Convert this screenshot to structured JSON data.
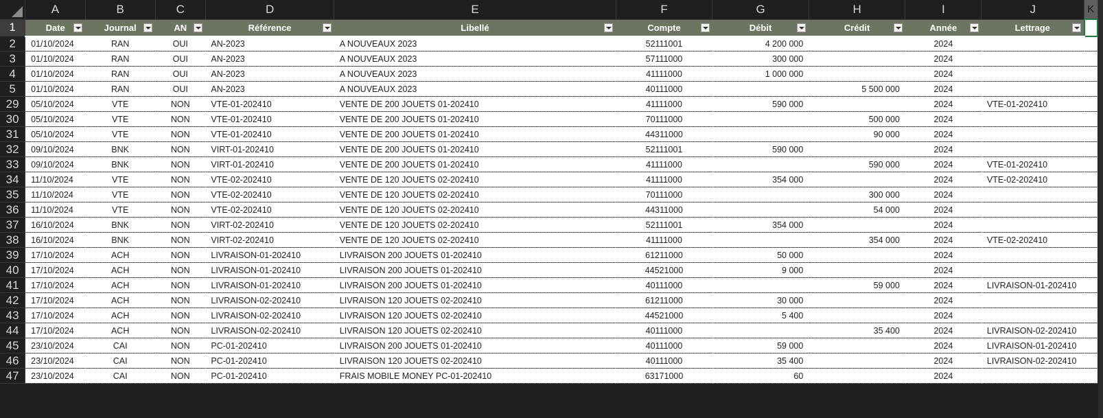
{
  "column_letters": [
    "A",
    "B",
    "C",
    "D",
    "E",
    "F",
    "G",
    "H",
    "I",
    "J",
    "K"
  ],
  "headers": [
    "Date",
    "Journal",
    "AN",
    "Référence",
    "Libellé",
    "Compte",
    "Débit",
    "Crédit",
    "Année",
    "Lettrage"
  ],
  "header_row_number": "1",
  "rows": [
    {
      "n": "2",
      "date": "01/10/2024",
      "journal": "RAN",
      "an": "OUI",
      "ref": "AN-2023",
      "libelle": "A NOUVEAUX 2023",
      "compte": "52111001",
      "debit": "4 200 000",
      "credit": "",
      "annee": "2024",
      "lettrage": ""
    },
    {
      "n": "3",
      "date": "01/10/2024",
      "journal": "RAN",
      "an": "OUI",
      "ref": "AN-2023",
      "libelle": "A NOUVEAUX 2023",
      "compte": "57111000",
      "debit": "300 000",
      "credit": "",
      "annee": "2024",
      "lettrage": ""
    },
    {
      "n": "4",
      "date": "01/10/2024",
      "journal": "RAN",
      "an": "OUI",
      "ref": "AN-2023",
      "libelle": "A NOUVEAUX 2023",
      "compte": "41111000",
      "debit": "1 000 000",
      "credit": "",
      "annee": "2024",
      "lettrage": ""
    },
    {
      "n": "5",
      "date": "01/10/2024",
      "journal": "RAN",
      "an": "OUI",
      "ref": "AN-2023",
      "libelle": "A NOUVEAUX 2023",
      "compte": "40111000",
      "debit": "",
      "credit": "5 500 000",
      "annee": "2024",
      "lettrage": ""
    },
    {
      "n": "29",
      "date": "05/10/2024",
      "journal": "VTE",
      "an": "NON",
      "ref": "VTE-01-202410",
      "libelle": "VENTE DE 200 JOUETS 01-202410",
      "compte": "41111000",
      "debit": "590 000",
      "credit": "",
      "annee": "2024",
      "lettrage": "VTE-01-202410"
    },
    {
      "n": "30",
      "date": "05/10/2024",
      "journal": "VTE",
      "an": "NON",
      "ref": "VTE-01-202410",
      "libelle": "VENTE DE 200 JOUETS 01-202410",
      "compte": "70111000",
      "debit": "",
      "credit": "500 000",
      "annee": "2024",
      "lettrage": ""
    },
    {
      "n": "31",
      "date": "05/10/2024",
      "journal": "VTE",
      "an": "NON",
      "ref": "VTE-01-202410",
      "libelle": "VENTE DE 200 JOUETS 01-202410",
      "compte": "44311000",
      "debit": "",
      "credit": "90 000",
      "annee": "2024",
      "lettrage": ""
    },
    {
      "n": "32",
      "date": "09/10/2024",
      "journal": "BNK",
      "an": "NON",
      "ref": "VIRT-01-202410",
      "libelle": "VENTE DE 200 JOUETS 01-202410",
      "compte": "52111001",
      "debit": "590 000",
      "credit": "",
      "annee": "2024",
      "lettrage": ""
    },
    {
      "n": "33",
      "date": "09/10/2024",
      "journal": "BNK",
      "an": "NON",
      "ref": "VIRT-01-202410",
      "libelle": "VENTE DE 200 JOUETS 01-202410",
      "compte": "41111000",
      "debit": "",
      "credit": "590 000",
      "annee": "2024",
      "lettrage": "VTE-01-202410"
    },
    {
      "n": "34",
      "date": "11/10/2024",
      "journal": "VTE",
      "an": "NON",
      "ref": "VTE-02-202410",
      "libelle": "VENTE DE 120 JOUETS 02-202410",
      "compte": "41111000",
      "debit": "354 000",
      "credit": "",
      "annee": "2024",
      "lettrage": "VTE-02-202410"
    },
    {
      "n": "35",
      "date": "11/10/2024",
      "journal": "VTE",
      "an": "NON",
      "ref": "VTE-02-202410",
      "libelle": "VENTE DE 120 JOUETS 02-202410",
      "compte": "70111000",
      "debit": "",
      "credit": "300 000",
      "annee": "2024",
      "lettrage": ""
    },
    {
      "n": "36",
      "date": "11/10/2024",
      "journal": "VTE",
      "an": "NON",
      "ref": "VTE-02-202410",
      "libelle": "VENTE DE 120 JOUETS 02-202410",
      "compte": "44311000",
      "debit": "",
      "credit": "54 000",
      "annee": "2024",
      "lettrage": ""
    },
    {
      "n": "37",
      "date": "16/10/2024",
      "journal": "BNK",
      "an": "NON",
      "ref": "VIRT-02-202410",
      "libelle": "VENTE DE 120 JOUETS 02-202410",
      "compte": "52111001",
      "debit": "354 000",
      "credit": "",
      "annee": "2024",
      "lettrage": ""
    },
    {
      "n": "38",
      "date": "16/10/2024",
      "journal": "BNK",
      "an": "NON",
      "ref": "VIRT-02-202410",
      "libelle": "VENTE DE 120 JOUETS 02-202410",
      "compte": "41111000",
      "debit": "",
      "credit": "354 000",
      "annee": "2024",
      "lettrage": "VTE-02-202410"
    },
    {
      "n": "39",
      "date": "17/10/2024",
      "journal": "ACH",
      "an": "NON",
      "ref": "LIVRAISON-01-202410",
      "libelle": "LIVRAISON 200 JOUETS 01-202410",
      "compte": "61211000",
      "debit": "50 000",
      "credit": "",
      "annee": "2024",
      "lettrage": ""
    },
    {
      "n": "40",
      "date": "17/10/2024",
      "journal": "ACH",
      "an": "NON",
      "ref": "LIVRAISON-01-202410",
      "libelle": "LIVRAISON 200 JOUETS 01-202410",
      "compte": "44521000",
      "debit": "9 000",
      "credit": "",
      "annee": "2024",
      "lettrage": ""
    },
    {
      "n": "41",
      "date": "17/10/2024",
      "journal": "ACH",
      "an": "NON",
      "ref": "LIVRAISON-01-202410",
      "libelle": "LIVRAISON 200 JOUETS 01-202410",
      "compte": "40111000",
      "debit": "",
      "credit": "59 000",
      "annee": "2024",
      "lettrage": "LIVRAISON-01-202410"
    },
    {
      "n": "42",
      "date": "17/10/2024",
      "journal": "ACH",
      "an": "NON",
      "ref": "LIVRAISON-02-202410",
      "libelle": "LIVRAISON 120 JOUETS 02-202410",
      "compte": "61211000",
      "debit": "30 000",
      "credit": "",
      "annee": "2024",
      "lettrage": ""
    },
    {
      "n": "43",
      "date": "17/10/2024",
      "journal": "ACH",
      "an": "NON",
      "ref": "LIVRAISON-02-202410",
      "libelle": "LIVRAISON 120 JOUETS 02-202410",
      "compte": "44521000",
      "debit": "5 400",
      "credit": "",
      "annee": "2024",
      "lettrage": ""
    },
    {
      "n": "44",
      "date": "17/10/2024",
      "journal": "ACH",
      "an": "NON",
      "ref": "LIVRAISON-02-202410",
      "libelle": "LIVRAISON 120 JOUETS 02-202410",
      "compte": "40111000",
      "debit": "",
      "credit": "35 400",
      "annee": "2024",
      "lettrage": "LIVRAISON-02-202410"
    },
    {
      "n": "45",
      "date": "23/10/2024",
      "journal": "CAI",
      "an": "NON",
      "ref": "PC-01-202410",
      "libelle": "LIVRAISON 200 JOUETS 01-202410",
      "compte": "40111000",
      "debit": "59 000",
      "credit": "",
      "annee": "2024",
      "lettrage": "LIVRAISON-01-202410"
    },
    {
      "n": "46",
      "date": "23/10/2024",
      "journal": "CAI",
      "an": "NON",
      "ref": "PC-01-202410",
      "libelle": "LIVRAISON 120 JOUETS 02-202410",
      "compte": "40111000",
      "debit": "35 400",
      "credit": "",
      "annee": "2024",
      "lettrage": "LIVRAISON-02-202410"
    },
    {
      "n": "47",
      "date": "23/10/2024",
      "journal": "CAI",
      "an": "NON",
      "ref": "PC-01-202410",
      "libelle": "FRAIS MOBILE MONEY PC-01-202410",
      "compte": "63171000",
      "debit": "60",
      "credit": "",
      "annee": "2024",
      "lettrage": ""
    }
  ]
}
